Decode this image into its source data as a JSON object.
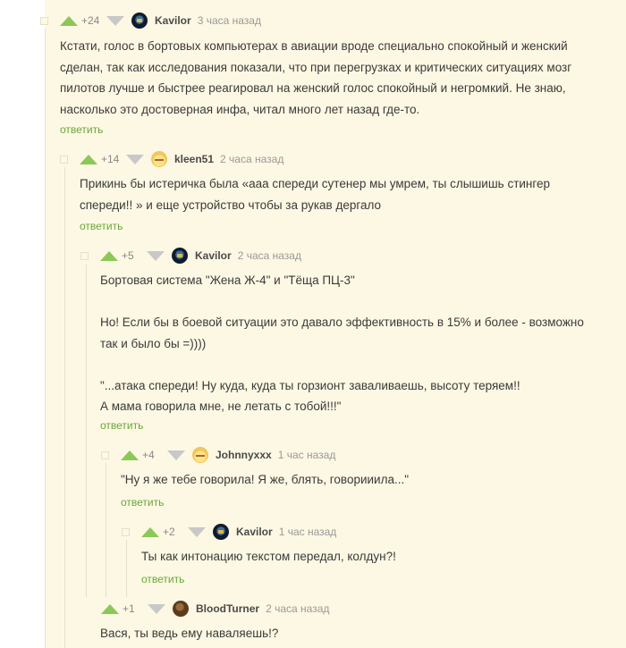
{
  "comments": [
    {
      "rating": "+24",
      "author": "Kavilor",
      "time": "3 часа назад",
      "avatar": "avatar-dark-emblem",
      "text": [
        "Кстати, голос в бортовых компьютерах в авиации вроде специально спокойный и женский",
        "сделан, так как исследования показали, что при перегрузках и критических ситуациях мозг",
        "пилотов лучше и быстрее реагировал на женский голос спокойный и негромкий. Не знаю,",
        "насколько это достоверная инфа, читал много лет назад где-то."
      ],
      "reply": "ответить"
    },
    {
      "rating": "+14",
      "author": "kleen51",
      "time": "2 часа назад",
      "avatar": "avatar-cat",
      "text": [
        "Прикинь бы истеричка была «ааа спереди сутенер мы умрем, ты слышишь стингер",
        "спереди!! » и еще устройство чтобы за рукав дергало"
      ],
      "reply": "ответить"
    },
    {
      "rating": "+5",
      "author": "Kavilor",
      "time": "2 часа назад",
      "avatar": "avatar-dark-emblem",
      "text": [
        "Бортовая система \"Жена Ж-4\" и \"Тёща ПЦ-3\"",
        "",
        "Но! Если бы в боевой ситуации это давало эффективность в 15% и более - возможно",
        "так и было бы =))))",
        "",
        "\"...атака спереди! Ну куда, куда ты горзионт заваливаешь, высоту теряем!!",
        "А мама говорила мне, не летать с тобой!!!\""
      ],
      "reply": "ответить"
    },
    {
      "rating": "+4",
      "author": "Johnnyxxx",
      "time": "1 час назад",
      "avatar": "avatar-cat",
      "text": [
        "\"Ну я же тебе говорила! Я же, блять, говорииила...\""
      ],
      "reply": "ответить"
    },
    {
      "rating": "+2",
      "author": "Kavilor",
      "time": "1 час назад",
      "avatar": "avatar-dark-emblem",
      "text": [
        "Ты как интонацию текстом передал, колдун?!"
      ],
      "reply": "ответить"
    },
    {
      "rating": "+1",
      "author": "BloodTurner",
      "time": "2 часа назад",
      "avatar": "avatar-brown",
      "text": [
        "Вася, ты ведь ему наваляешь!?"
      ]
    }
  ],
  "colors": {
    "background": "#fdf8e3",
    "upvote": "#8ac858",
    "downvote": "#c8c8c8",
    "reply_link": "#6aa63b"
  }
}
